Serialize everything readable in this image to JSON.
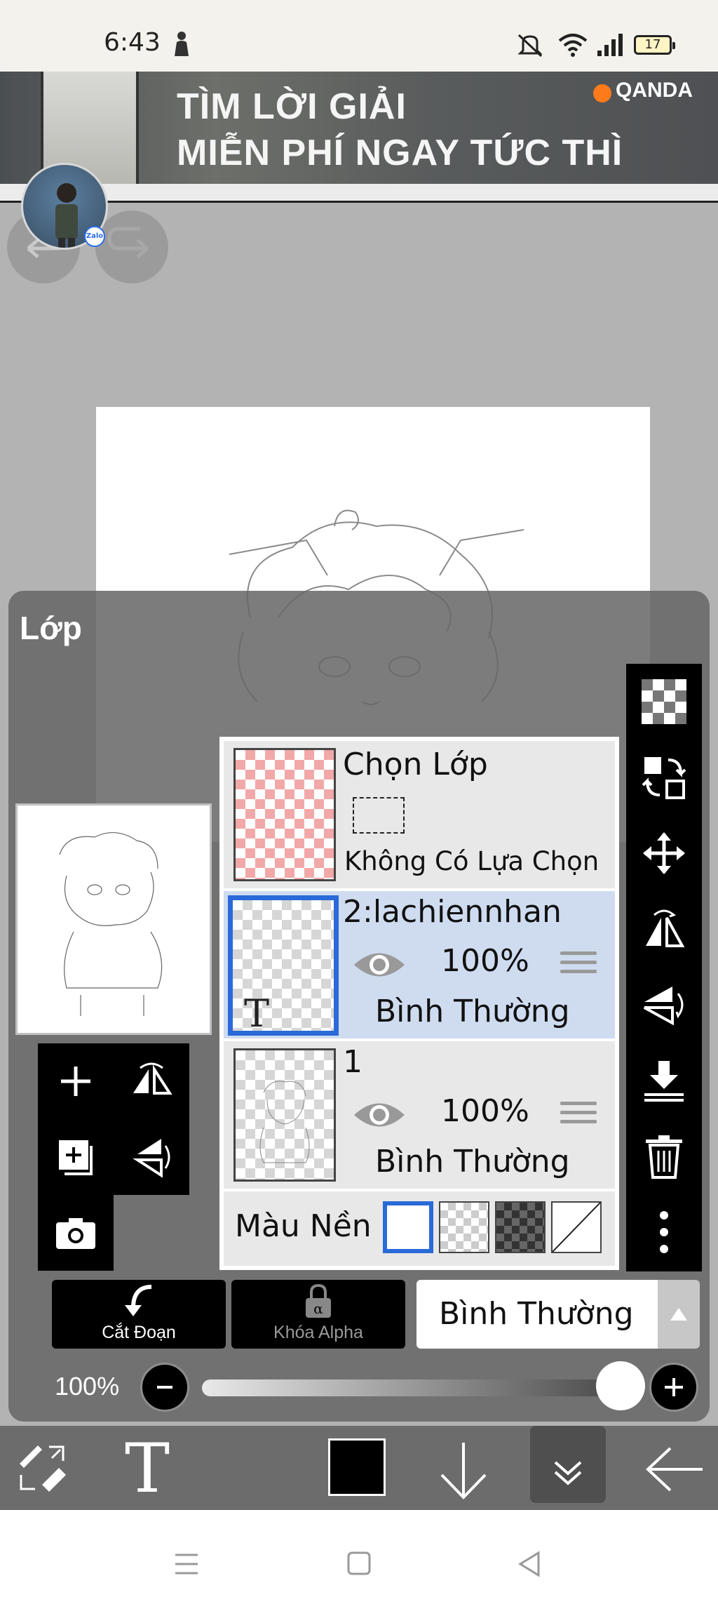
{
  "status_bar": {
    "time": "6:43",
    "battery": "17"
  },
  "ad": {
    "line1": "TÌM LỜI GIẢI",
    "line2": "MIỄN PHÍ NGAY TỨC THÌ",
    "brand": "QANDA"
  },
  "avatar": {
    "badge": "Zalo"
  },
  "panel": {
    "title": "Lớp"
  },
  "selection_layer": {
    "title": "Chọn Lớp",
    "status": "Không Có Lựa Chọn"
  },
  "layers": [
    {
      "name": "2:lachiennhan",
      "opacity": "100%",
      "blend": "Bình Thường",
      "thumb_letter": "T",
      "active": true
    },
    {
      "name": "1",
      "opacity": "100%",
      "blend": "Bình Thường",
      "active": false
    }
  ],
  "background": {
    "label": "Màu Nền",
    "options": [
      "white",
      "checker",
      "dark-checker",
      "none"
    ],
    "selected": "white"
  },
  "actions": {
    "clip_label": "Cắt Đoạn",
    "alpha_lock_label": "Khóa Alpha",
    "blend_mode": "Bình Thường"
  },
  "opacity": {
    "label": "100%",
    "value": 1.0
  },
  "toolbar": {
    "current_color": "#000000"
  },
  "colors": {
    "active_blue": "#2a6ad8",
    "panel_gray": "#666666",
    "selected_row": "#cfdcf0"
  }
}
